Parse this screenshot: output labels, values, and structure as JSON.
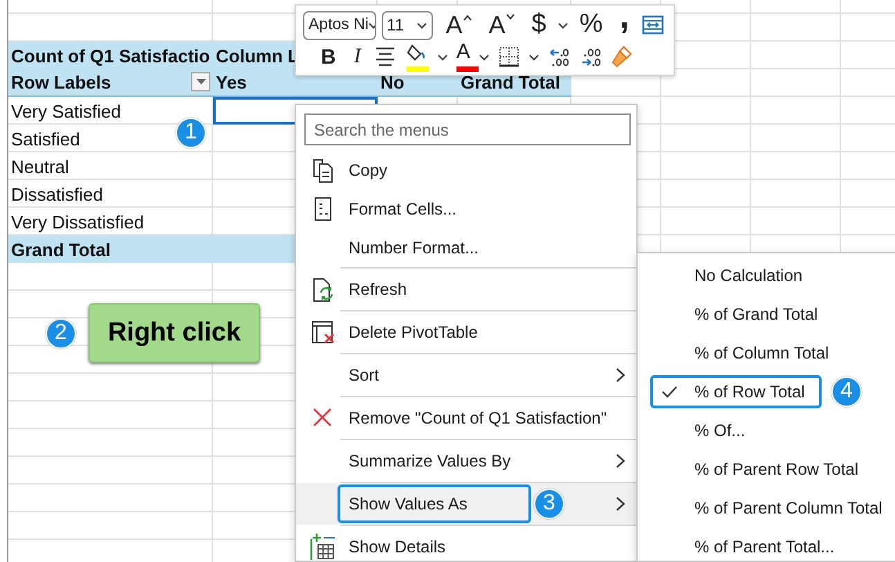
{
  "pivot": {
    "title": [
      "Count of Q1 Satisfactio",
      "Column L"
    ],
    "headers": {
      "row_labels": "Row Labels",
      "columns": [
        "Yes",
        "No",
        "Grand Total"
      ]
    },
    "rows": [
      {
        "label": "Very Satisfied",
        "selected": true,
        "callout": "1"
      },
      {
        "label": "Satisfied",
        "selected": false
      },
      {
        "label": "Neutral",
        "selected": false
      },
      {
        "label": "Dissatisfied",
        "selected": false
      },
      {
        "label": "Very Dissatisfied",
        "selected": false
      }
    ],
    "total": "Grand Total"
  },
  "hint_button": {
    "label": "Right click",
    "callout": "2"
  },
  "mini_toolbar": {
    "font": "Aptos Ni",
    "size": "11",
    "rows": [
      [
        {
          "kind": "grow",
          "label": "A"
        },
        {
          "kind": "shrink",
          "label": "A"
        },
        {
          "kind": "currency",
          "label": "$",
          "dropdown": true
        },
        {
          "kind": "percent",
          "label": "%"
        },
        {
          "kind": "comma",
          "label": ","
        },
        {
          "kind": "wrap"
        }
      ],
      [
        {
          "kind": "bold",
          "label": "B"
        },
        {
          "kind": "italic",
          "label": "I"
        },
        {
          "kind": "align"
        },
        {
          "kind": "fill",
          "color": "#ffff00",
          "dropdown": true
        },
        {
          "kind": "font-color",
          "label": "A",
          "color": "#ff0000",
          "dropdown": true
        },
        {
          "kind": "borders",
          "dropdown": true
        },
        {
          "kind": "increase-decimal"
        },
        {
          "kind": "decrease-decimal"
        },
        {
          "kind": "painter"
        }
      ]
    ]
  },
  "context_menu": {
    "search_placeholder": "Search the menus",
    "items": [
      {
        "label": "Copy",
        "kind": "copy",
        "separator_above": false,
        "submenu": false,
        "highlighted": false
      },
      {
        "label": "Format Cells...",
        "kind": "format",
        "separator_above": false,
        "submenu": false,
        "highlighted": false
      },
      {
        "label": "Number Format...",
        "separator_above": false,
        "submenu": false,
        "highlighted": false
      },
      {
        "label": "Refresh",
        "kind": "refresh",
        "separator_above": true,
        "submenu": false,
        "highlighted": false
      },
      {
        "label": "Delete PivotTable",
        "kind": "delete",
        "separator_above": true,
        "submenu": false,
        "highlighted": false
      },
      {
        "label": "Sort",
        "separator_above": true,
        "submenu": true,
        "highlighted": false
      },
      {
        "label": "Remove \"Count of Q1 Satisfaction\"",
        "kind": "remove",
        "separator_above": true,
        "submenu": false,
        "highlighted": false
      },
      {
        "label": "Summarize Values By",
        "separator_above": true,
        "submenu": true,
        "highlighted": false
      },
      {
        "label": "Show Values As",
        "separator_above": true,
        "submenu": true,
        "highlighted": true,
        "outlined": true,
        "callout": "3"
      },
      {
        "label": "Show Details",
        "kind": "details",
        "separator_above": true,
        "submenu": false,
        "highlighted": false
      }
    ]
  },
  "submenu": {
    "items": [
      {
        "label": "No Calculation",
        "checked": false
      },
      {
        "label": "% of Grand Total",
        "checked": false
      },
      {
        "label": "% of Column Total",
        "checked": false
      },
      {
        "label": "% of Row Total",
        "checked": true,
        "outlined": true,
        "callout": "4"
      },
      {
        "label": "% Of...",
        "checked": false
      },
      {
        "label": "% of Parent Row Total",
        "checked": false
      },
      {
        "label": "% of Parent Column Total",
        "checked": false
      },
      {
        "label": "% of Parent Total...",
        "checked": false
      }
    ]
  }
}
